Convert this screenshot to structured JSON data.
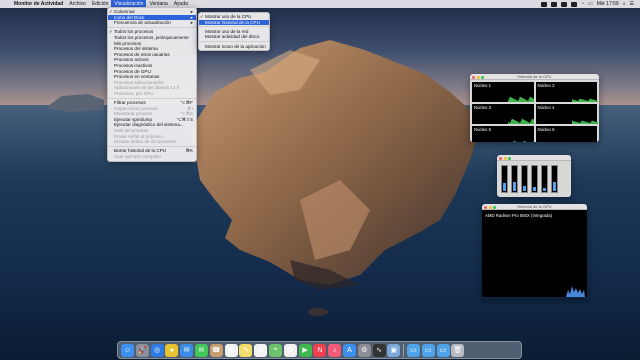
{
  "menubar": {
    "app": "Monitor de Actividad",
    "items": [
      "Archivo",
      "Edición",
      "Visualización",
      "Ventana",
      "Ayuda"
    ],
    "clock": "Mié 17:59"
  },
  "view_menu": {
    "items": [
      {
        "label": "Columnas",
        "checked": true,
        "submenu": true
      },
      {
        "label": "Icono del Dock",
        "submenu": true,
        "highlighted": true
      },
      {
        "label": "Frecuencia de actualización",
        "submenu": true
      },
      {
        "sep": true
      },
      {
        "label": "Todos los procesos",
        "checked": true
      },
      {
        "label": "Todos los procesos, jerárquicamente"
      },
      {
        "label": "Mis procesos"
      },
      {
        "label": "Procesos del sistema"
      },
      {
        "label": "Procesos de otros usuarios"
      },
      {
        "label": "Procesos activos"
      },
      {
        "label": "Procesos inactivos"
      },
      {
        "label": "Procesos de GPU"
      },
      {
        "label": "Procesos en ventanas"
      },
      {
        "label": "Procesos seleccionados",
        "disabled": true
      },
      {
        "label": "Aplicaciones en las últimas 12 h",
        "disabled": true
      },
      {
        "label": "Procesos, por GPU",
        "disabled": true
      },
      {
        "sep": true
      },
      {
        "label": "Filtrar procesos",
        "shortcut": "⌥⌘F"
      },
      {
        "label": "Inspeccionar proceso",
        "disabled": true,
        "shortcut": "⌘I"
      },
      {
        "label": "Muestrear proceso",
        "disabled": true,
        "shortcut": "⌥⌘S"
      },
      {
        "label": "Ejecutar spindump",
        "shortcut": "⌥⌘⇧S"
      },
      {
        "label": "Ejecutar diagnóstico del sistema..."
      },
      {
        "label": "Salir del proceso",
        "disabled": true
      },
      {
        "label": "Enviar señal al proceso...",
        "disabled": true
      },
      {
        "label": "Mostrar deltas de los procesos",
        "disabled": true
      },
      {
        "sep": true
      },
      {
        "label": "Borrar historial de la CPU",
        "shortcut": "⌘K"
      },
      {
        "label": "Usar ejemplo completo",
        "disabled": true
      }
    ]
  },
  "dock_submenu": {
    "items": [
      {
        "label": "Mostrar uso de la CPU",
        "checked": true
      },
      {
        "label": "Mostrar historial de la CPU",
        "highlighted": true
      },
      {
        "sep": true
      },
      {
        "label": "Mostrar uso de la red"
      },
      {
        "label": "Mostrar actividad del disco"
      },
      {
        "sep": true
      },
      {
        "label": "Mostrar icono de la aplicación"
      }
    ]
  },
  "cpu_history_window": {
    "title": "Historial de la CPU",
    "cores": [
      "Núcleo 1",
      "Núcleo 2",
      "Núcleo 3",
      "Núcleo 4",
      "Núcleo 5",
      "Núcleo 6"
    ]
  },
  "cpu_usage_window": {
    "levels": [
      0.32,
      0.36,
      0.18,
      0.14,
      0.12,
      0.34
    ]
  },
  "gpu_history_window": {
    "title": "Historial de la GPU",
    "gpu_name": "AMD Radeon Pro 560X (Integrada)"
  },
  "dock": {
    "apps": [
      {
        "name": "finder",
        "color": "#3d8ff0",
        "glyph": "☺"
      },
      {
        "name": "launchpad",
        "color": "#8a8f9a",
        "glyph": "🚀"
      },
      {
        "name": "safari",
        "color": "#2f7be6",
        "glyph": "◎"
      },
      {
        "name": "chrome",
        "color": "#e8c430",
        "glyph": "●"
      },
      {
        "name": "mail",
        "color": "#3b8de8",
        "glyph": "✉"
      },
      {
        "name": "messages",
        "color": "#43c65a",
        "glyph": "✉"
      },
      {
        "name": "contacts",
        "color": "#c8a070",
        "glyph": "☎"
      },
      {
        "name": "calendar",
        "color": "#f2f2f2",
        "glyph": "▦"
      },
      {
        "name": "notes",
        "color": "#f5dd6a",
        "glyph": "✎"
      },
      {
        "name": "reminders",
        "color": "#f4f4f4",
        "glyph": "☰"
      },
      {
        "name": "maps",
        "color": "#6cc36c",
        "glyph": "⌖"
      },
      {
        "name": "photos",
        "color": "#f1f1f1",
        "glyph": "✿"
      },
      {
        "name": "facetime",
        "color": "#3cb84c",
        "glyph": "▶"
      },
      {
        "name": "news",
        "color": "#f04050",
        "glyph": "N"
      },
      {
        "name": "music",
        "color": "#f45a78",
        "glyph": "♪"
      },
      {
        "name": "appstore",
        "color": "#3d8ff0",
        "glyph": "A"
      },
      {
        "name": "settings",
        "color": "#8d8d95",
        "glyph": "⚙"
      },
      {
        "name": "activitymonitor",
        "color": "#333333",
        "glyph": "∿"
      },
      {
        "name": "preview",
        "color": "#7aa8d8",
        "glyph": "▣"
      }
    ],
    "extras": [
      {
        "name": "folder-downloads",
        "color": "#4fa3e8",
        "glyph": "▭"
      },
      {
        "name": "folder-documents",
        "color": "#4fa3e8",
        "glyph": "▭"
      },
      {
        "name": "folder-applications",
        "color": "#4fa3e8",
        "glyph": "▭"
      },
      {
        "name": "trash",
        "color": "#b7bcc4",
        "glyph": "🗑"
      }
    ]
  }
}
